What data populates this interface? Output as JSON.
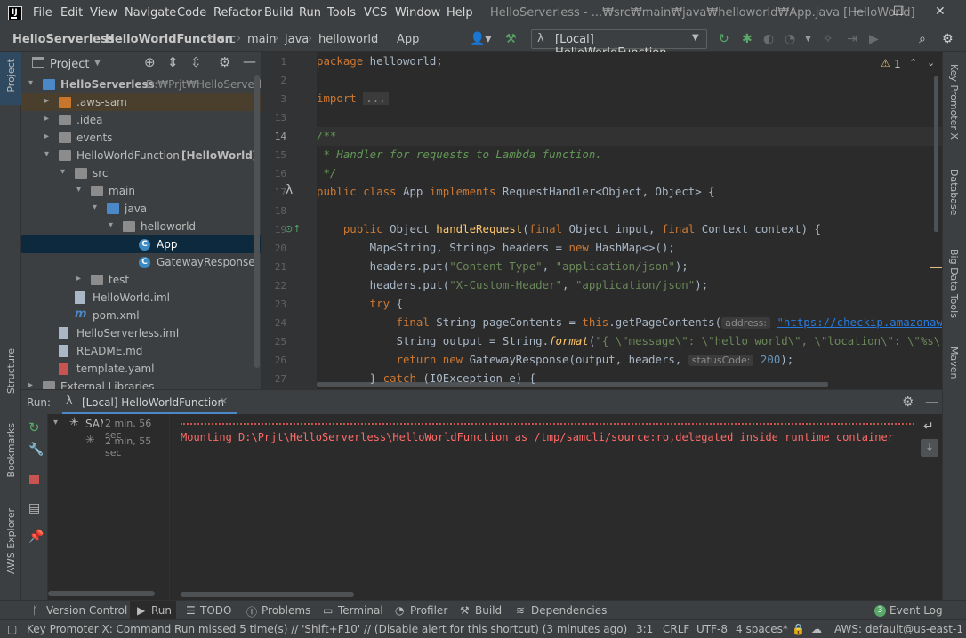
{
  "window": {
    "title": "HelloServerless - ...₩src₩main₩java₩helloworld₩App.java [HelloWorld]",
    "minimize": "—",
    "maximize": "☐",
    "close": "✕"
  },
  "menu": [
    "File",
    "Edit",
    "View",
    "Navigate",
    "Code",
    "Refactor",
    "Build",
    "Run",
    "Tools",
    "VCS",
    "Window",
    "Help"
  ],
  "breadcrumbs": [
    "HelloServerless",
    "HelloWorldFunction",
    "src",
    "main",
    "java",
    "helloworld",
    "App"
  ],
  "run_config": {
    "label": "[Local] HelloWorldFunction"
  },
  "left_stripe": {
    "project": "Project",
    "structure": "Structure",
    "bookmarks": "Bookmarks",
    "aws_explorer": "AWS Explorer"
  },
  "right_stripe": {
    "key_promoter": "Key Promoter X",
    "database": "Database",
    "big_data_tools": "Big Data Tools",
    "maven": "Maven"
  },
  "project": {
    "title": "Project",
    "tree": [
      {
        "label": "HelloServerless",
        "extra": "D:₩Prjt₩HelloServerle",
        "depth": 0,
        "arrow": "▾",
        "icon": "folder-blue",
        "bold": true
      },
      {
        "label": ".aws-sam",
        "extra": "",
        "depth": 1,
        "arrow": "▸",
        "icon": "folder-orange",
        "bold": false,
        "highlight": true
      },
      {
        "label": ".idea",
        "extra": "",
        "depth": 1,
        "arrow": "▸",
        "icon": "folder",
        "bold": false
      },
      {
        "label": "events",
        "extra": "",
        "depth": 1,
        "arrow": "▸",
        "icon": "folder",
        "bold": false
      },
      {
        "label": "HelloWorldFunction",
        "extra": "[HelloWorld]",
        "depth": 1,
        "arrow": "▾",
        "icon": "folder",
        "bold": false
      },
      {
        "label": "src",
        "extra": "",
        "depth": 2,
        "arrow": "▾",
        "icon": "folder",
        "bold": false
      },
      {
        "label": "main",
        "extra": "",
        "depth": 3,
        "arrow": "▾",
        "icon": "folder",
        "bold": false
      },
      {
        "label": "java",
        "extra": "",
        "depth": 4,
        "arrow": "▾",
        "icon": "folder-blue",
        "bold": false
      },
      {
        "label": "helloworld",
        "extra": "",
        "depth": 5,
        "arrow": "▾",
        "icon": "folder",
        "bold": false
      },
      {
        "label": "App",
        "extra": "",
        "depth": 6,
        "arrow": "",
        "icon": "class",
        "bold": false,
        "selected": true
      },
      {
        "label": "GatewayResponse",
        "extra": "",
        "depth": 6,
        "arrow": "",
        "icon": "class",
        "bold": false
      },
      {
        "label": "test",
        "extra": "",
        "depth": 3,
        "arrow": "▸",
        "icon": "folder",
        "bold": false
      },
      {
        "label": "HelloWorld.iml",
        "extra": "",
        "depth": 2,
        "arrow": "",
        "icon": "file",
        "bold": false
      },
      {
        "label": "pom.xml",
        "extra": "",
        "depth": 2,
        "arrow": "",
        "icon": "maven",
        "bold": false
      },
      {
        "label": "HelloServerless.iml",
        "extra": "",
        "depth": 1,
        "arrow": "",
        "icon": "file",
        "bold": false
      },
      {
        "label": "README.md",
        "extra": "",
        "depth": 1,
        "arrow": "",
        "icon": "file",
        "bold": false
      },
      {
        "label": "template.yaml",
        "extra": "",
        "depth": 1,
        "arrow": "",
        "icon": "yaml",
        "bold": false
      },
      {
        "label": "External Libraries",
        "extra": "",
        "depth": 0,
        "arrow": "▸",
        "icon": "folder",
        "bold": false
      }
    ]
  },
  "editor": {
    "warning_count": "1",
    "line_numbers": [
      "1",
      "2",
      "3",
      "13",
      "14",
      "15",
      "16",
      "17",
      "18",
      "19",
      "20",
      "21",
      "22",
      "23",
      "24",
      "25",
      "26",
      "27"
    ],
    "lines": {
      "l1_kw": "package",
      "l1_rest": " helloworld;",
      "l3_kw": "import",
      "l3_fold": "...",
      "l14": "/**",
      "l15": " * Handler for requests to Lambda function.",
      "l16": " */",
      "l17_a": "public class",
      "l17_b": " App ",
      "l17_c": "implements",
      "l17_d": " RequestHandler<Object, Object> {",
      "l19_a": "    public",
      "l19_b": " Object ",
      "l19_fn": "handleRequest",
      "l19_c": "(",
      "l19_d": "final",
      "l19_e": " Object input, ",
      "l19_f": "final",
      "l19_g": " Context context) {",
      "l20_a": "        Map<String, String> headers = ",
      "l20_kw": "new",
      "l20_b": " HashMap<>();",
      "l21_a": "        headers.put(",
      "l21_s1": "\"Content-Type\"",
      "l21_b": ", ",
      "l21_s2": "\"application/json\"",
      "l21_c": ");",
      "l22_a": "        headers.put(",
      "l22_s1": "\"X-Custom-Header\"",
      "l22_b": ", ",
      "l22_s2": "\"application/json\"",
      "l22_c": ");",
      "l23_kw": "        try",
      "l23_b": " {",
      "l24_kw": "            final",
      "l24_a": " String pageContents = ",
      "l24_kw2": "this",
      "l24_b": ".getPageContents(",
      "l24_hint": "address:",
      "l24_url": "\"https://checkip.amazonaws.com\"",
      "l24_c": ");",
      "l25_a": "            String output = String.",
      "l25_fn": "format",
      "l25_b": "(",
      "l25_s": "\"{ \\\"message\\\": \\\"hello world\\\", \\\"location\\\": \\\"%s\\\" }\"",
      "l25_c": ", p",
      "l26_kw": "            return new",
      "l26_a": " GatewayResponse(output, headers, ",
      "l26_hint": "statusCode:",
      "l26_num": "200",
      "l26_b": ");",
      "l27_a": "        } ",
      "l27_kw": "catch",
      "l27_b": " (IOException e) {"
    }
  },
  "run_panel": {
    "label": "Run:",
    "tab": "[Local] HelloWorldFunction",
    "tree": [
      {
        "label": "SAM",
        "time": "2 min, 56 sec"
      },
      {
        "label": "",
        "time": "2 min, 55 sec"
      }
    ],
    "console_line": "Mounting D:\\Prjt\\HelloServerless\\HelloWorldFunction as /tmp/samcli/source:ro,delegated inside runtime container"
  },
  "tool_tabs": [
    "Version Control",
    "Run",
    "TODO",
    "Problems",
    "Terminal",
    "Profiler",
    "Build",
    "Dependencies"
  ],
  "event_log": {
    "count": "3",
    "label": "Event Log"
  },
  "status": {
    "message": "Key Promoter X: Command Run missed 5 time(s) // 'Shift+F10' // (Disable alert for this shortcut) (3 minutes ago)",
    "position": "3:1",
    "line_sep": "CRLF",
    "encoding": "UTF-8",
    "indent": "4 spaces*",
    "aws": "AWS: default@us-east-1"
  },
  "colors": {
    "accent": "#4a88c7",
    "error_text": "#ff6b68",
    "stop": "#c75450",
    "run": "#59a869"
  }
}
